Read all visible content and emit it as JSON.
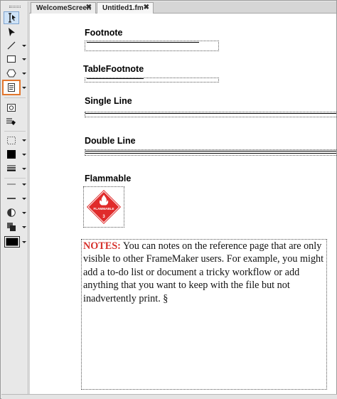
{
  "tabs": [
    {
      "label": "WelcomeScreen",
      "close": "✖"
    },
    {
      "label": "Untitled1.fm",
      "close": "✖"
    }
  ],
  "document": {
    "headings": {
      "footnote": "Footnote",
      "table_footnote": "TableFootnote",
      "single_line": "Single Line",
      "double_line": "Double Line",
      "flammable": "Flammable"
    },
    "hazard_sign": {
      "label": "FLAMMABLE",
      "class_number": "3",
      "color": "#e02b2b"
    },
    "notes": {
      "label": "NOTES:",
      "text": " You can notes on the reference page that are only visible to other FrameMaker users. For example, you might add a to-do list or document a tricky workflow or add anything that you want to keep with the file but not inadvertently print. §"
    }
  },
  "toolbar": {
    "tools": [
      "text-cursor-icon",
      "select-arrow-icon",
      "line-icon",
      "rectangle-icon",
      "polygon-icon",
      "text-frame-icon",
      "anchored-frame-icon",
      "fill-icon",
      "marquee-icon",
      "fill-color-icon",
      "line-width-icon",
      "line-end-icon",
      "line-style-icon",
      "tint-icon",
      "overprint-icon",
      "color-icon"
    ],
    "highlight_color": "#e2762d"
  }
}
